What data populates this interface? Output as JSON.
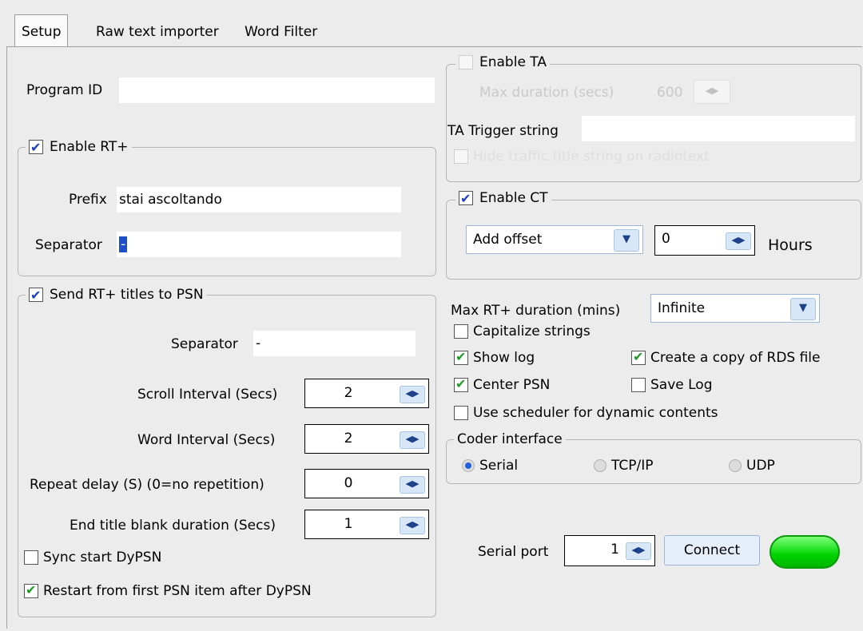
{
  "tabs": [
    "Setup",
    "Raw text importer",
    "Word Filter"
  ],
  "program_id": {
    "label": "Program ID",
    "value": ""
  },
  "rtplus": {
    "enable_label": "Enable RT+",
    "enabled": true,
    "prefix_label": "Prefix",
    "prefix_value": "stai ascoltando",
    "separator_label": "Separator",
    "separator_value": "-"
  },
  "psn": {
    "enable_label": "Send RT+ titles to PSN",
    "enabled": true,
    "separator_label": "Separator",
    "separator_value": "-",
    "scroll_interval_label": "Scroll Interval (Secs)",
    "scroll_interval_value": "2",
    "word_interval_label": "Word Interval (Secs)",
    "word_interval_value": "2",
    "repeat_delay_label": "Repeat delay (S) (0=no repetition)",
    "repeat_delay_value": "0",
    "end_blank_label": "End title blank duration (Secs)",
    "end_blank_value": "1",
    "sync_start_label": "Sync start DyPSN",
    "sync_start_checked": false,
    "restart_label": "Restart from first PSN item after DyPSN",
    "restart_checked": true
  },
  "ta": {
    "enable_label": "Enable TA",
    "enabled": false,
    "max_duration_label": "Max duration (secs)",
    "max_duration_value": "600",
    "trigger_label": "TA Trigger string",
    "trigger_value": "",
    "hide_label": "Hide traffic title string on radiotext"
  },
  "ct": {
    "enable_label": "Enable CT",
    "enabled": true,
    "mode_value": "Add offset",
    "offset_value": "0",
    "hours_label": "Hours"
  },
  "options": {
    "max_rt_label": "Max RT+ duration (mins)",
    "max_rt_value": "Infinite",
    "capitalize_label": "Capitalize strings",
    "capitalize_checked": false,
    "show_log_label": "Show log",
    "show_log_checked": true,
    "copy_rds_label": "Create a copy of RDS file",
    "copy_rds_checked": true,
    "center_psn_label": "Center PSN",
    "center_psn_checked": true,
    "save_log_label": "Save Log",
    "save_log_checked": false,
    "scheduler_label": "Use scheduler for dynamic contents",
    "scheduler_checked": false
  },
  "coder": {
    "title": "Coder interface",
    "options": [
      "Serial",
      "TCP/IP",
      "UDP"
    ],
    "selected": "Serial"
  },
  "serial": {
    "label": "Serial port",
    "value": "1",
    "connect_label": "Connect",
    "status_color": "#00dd00"
  }
}
